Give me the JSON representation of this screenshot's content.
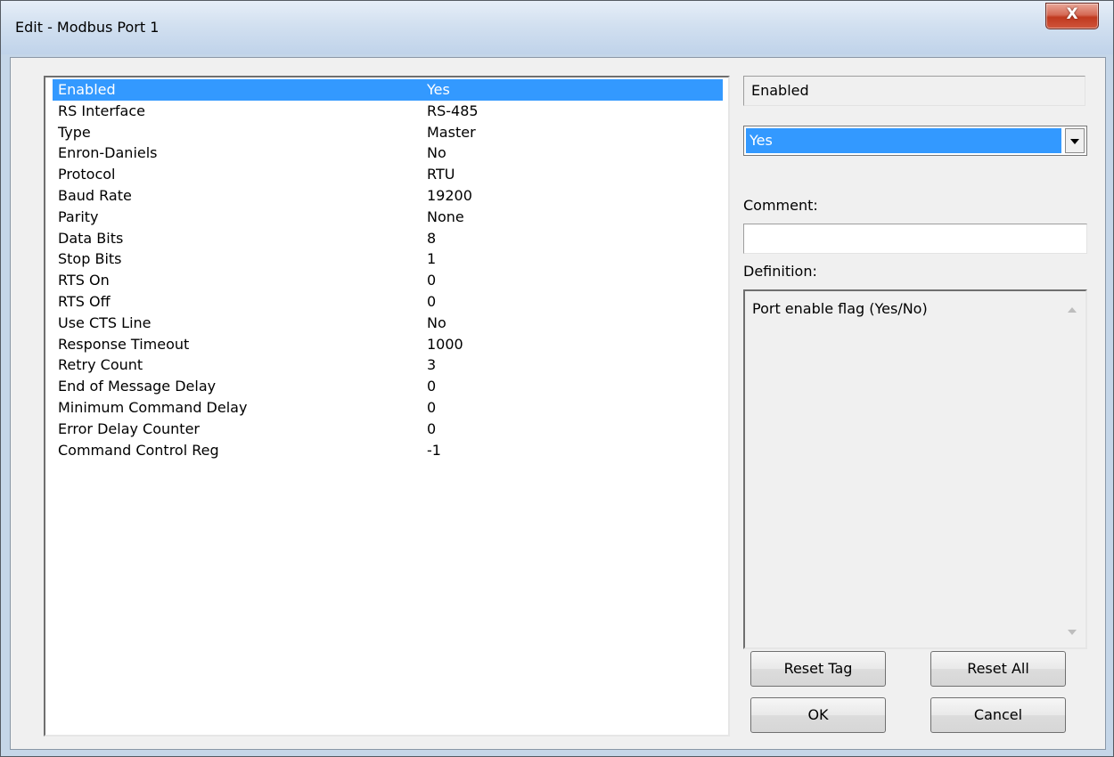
{
  "window": {
    "title": "Edit - Modbus Port 1",
    "close_label": "X"
  },
  "list": {
    "items": [
      {
        "name": "Enabled",
        "value": "Yes",
        "selected": true
      },
      {
        "name": "RS Interface",
        "value": "RS-485"
      },
      {
        "name": "Type",
        "value": "Master"
      },
      {
        "name": "Enron-Daniels",
        "value": "No"
      },
      {
        "name": "Protocol",
        "value": "RTU"
      },
      {
        "name": "Baud Rate",
        "value": "19200"
      },
      {
        "name": "Parity",
        "value": "None"
      },
      {
        "name": "Data Bits",
        "value": "8"
      },
      {
        "name": "Stop Bits",
        "value": "1"
      },
      {
        "name": "RTS On",
        "value": "0"
      },
      {
        "name": "RTS Off",
        "value": "0"
      },
      {
        "name": "Use CTS Line",
        "value": "No"
      },
      {
        "name": "Response Timeout",
        "value": "1000"
      },
      {
        "name": "Retry Count",
        "value": "3"
      },
      {
        "name": "End of Message Delay",
        "value": "0"
      },
      {
        "name": "Minimum Command Delay",
        "value": "0"
      },
      {
        "name": "Error Delay Counter",
        "value": "0"
      },
      {
        "name": "Command Control Reg",
        "value": "-1"
      }
    ]
  },
  "editor": {
    "field_name": "Enabled",
    "selected_value": "Yes",
    "comment_label": "Comment:",
    "comment_value": "",
    "definition_label": "Definition:",
    "definition_text": "Port enable flag (Yes/No)"
  },
  "buttons": {
    "reset_tag": "Reset Tag",
    "reset_all": "Reset All",
    "ok": "OK",
    "cancel": "Cancel"
  },
  "colors": {
    "selection": "#3399ff",
    "close_button": "#c0391f"
  }
}
